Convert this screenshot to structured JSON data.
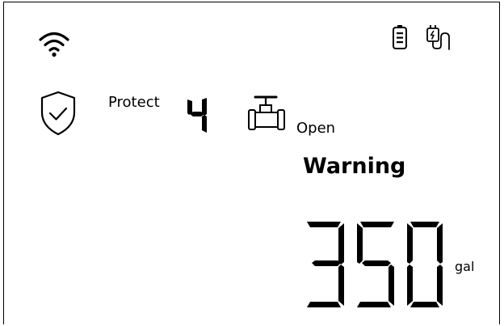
{
  "status_bar": {
    "wifi_icon": "wifi-icon",
    "battery_icon": "battery-icon",
    "plug_icon": "plug-icon"
  },
  "protect": {
    "icon": "shield-check-icon",
    "label": "Protect",
    "level": "4"
  },
  "valve": {
    "icon": "valve-icon",
    "state": "Open"
  },
  "alert": {
    "text": "Warning"
  },
  "volume": {
    "value": "350",
    "unit": "gal"
  }
}
